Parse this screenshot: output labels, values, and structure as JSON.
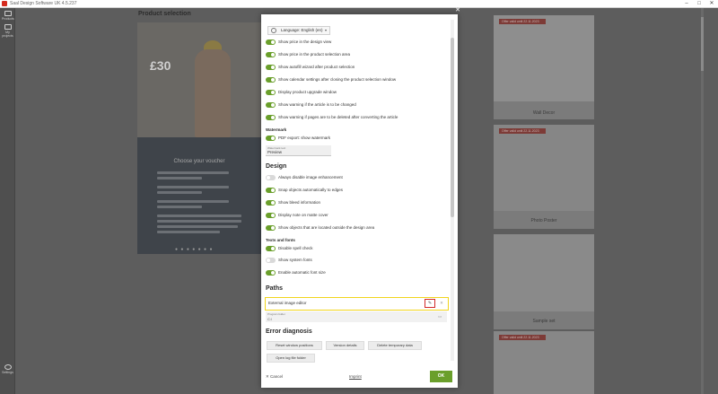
{
  "window": {
    "title": "Saal Design Software UK 4.5.237",
    "controls": [
      "minimize-icon",
      "maximize-icon",
      "close-icon"
    ]
  },
  "rail": {
    "items": [
      {
        "label": "Products",
        "icon": "products-icon"
      },
      {
        "label": "My projects",
        "icon": "projects-icon"
      },
      {
        "label": "Settings",
        "icon": "gear-icon"
      }
    ]
  },
  "background": {
    "section_title": "Product selection",
    "promo": {
      "price": "£30",
      "heading": "Choose your voucher",
      "dots": "● ● ● ● ● ● ●"
    },
    "cards": [
      {
        "badge": "Offer valid until 22.11.2023",
        "name": ""
      },
      {
        "badge": "",
        "name": "Wall Decor"
      },
      {
        "badge": "Offer valid until 22.11.2023",
        "name": ""
      },
      {
        "badge": "",
        "name": "Photo Poster"
      },
      {
        "badge": "",
        "name": "Sample set"
      },
      {
        "badge": "Offer valid until 22.11.2023",
        "name": ""
      }
    ]
  },
  "dialog": {
    "language_label": "Language: English (en)",
    "general_toggles": [
      {
        "label": "Show price in the design view",
        "on": true
      },
      {
        "label": "Show price in the product selection area",
        "on": true
      },
      {
        "label": "Show autofill wizard after product selection",
        "on": true
      },
      {
        "label": "Show calendar settings after closing the product selection window",
        "on": true
      },
      {
        "label": "Display product upgrade window",
        "on": true
      },
      {
        "label": "Show warning if the article is to be changed",
        "on": true
      },
      {
        "label": "Show warning if pages are to be deleted after converting the article",
        "on": true
      }
    ],
    "watermark": {
      "heading": "Watermark",
      "toggle_label": "PDF export: show watermark",
      "toggle_on": true,
      "field_label": "Watermark text",
      "field_value": "Preview"
    },
    "design": {
      "heading": "Design",
      "toggles": [
        {
          "label": "Always disable image enhancement",
          "on": false
        },
        {
          "label": "Snap objects automatically to edges",
          "on": true
        },
        {
          "label": "Show bleed information",
          "on": true
        },
        {
          "label": "Display note on matte cover",
          "on": true
        },
        {
          "label": "Show objects that are located outside the design area",
          "on": true
        }
      ]
    },
    "texts_fonts": {
      "heading": "Texts and fonts",
      "toggles": [
        {
          "label": "Disable spell check",
          "on": true
        },
        {
          "label": "Show system fonts",
          "on": false
        },
        {
          "label": "Enable automatic font size",
          "on": true
        }
      ]
    },
    "paths": {
      "heading": "Paths",
      "external_editor_label": "External image editor",
      "edit_icon": "pencil-icon",
      "clear_icon": "close-icon",
      "program_folder_label": "Program folder",
      "program_folder_value": "C:\\",
      "folder_icon": "folder-icon"
    },
    "error_diagnosis": {
      "heading": "Error diagnosis",
      "buttons": {
        "reset": "Reset window positions",
        "version": "Version details",
        "delete_temp": "Delete temporary data",
        "open_log": "Open log file folder"
      }
    },
    "footer": {
      "cancel": "Cancel",
      "imprint": "Imprint",
      "ok": "OK"
    }
  },
  "colors": {
    "accent_green": "#6a9f2b",
    "highlight_yellow": "#f1d51d",
    "highlight_red": "#d12a2a",
    "badge_red": "#7d3b37"
  }
}
